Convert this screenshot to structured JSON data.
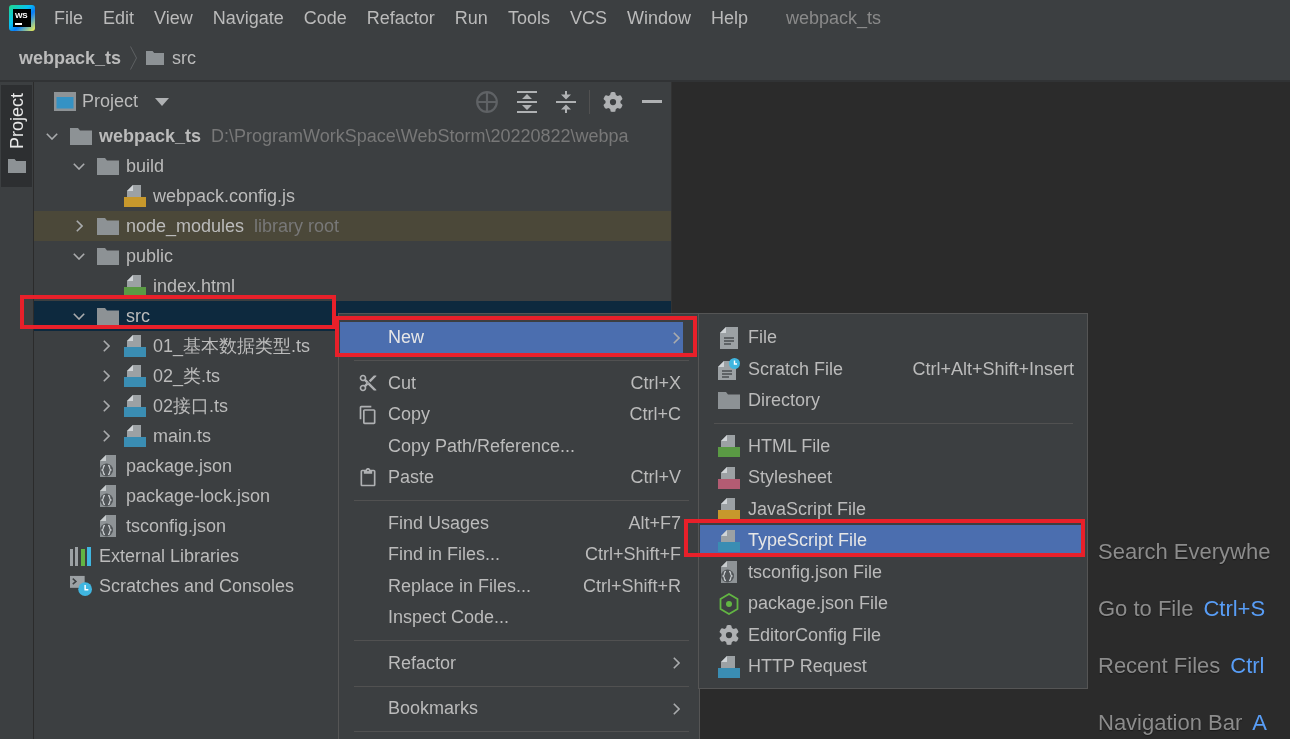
{
  "app_logo": {
    "text": "WS"
  },
  "menu_bar": {
    "items": [
      "File",
      "Edit",
      "View",
      "Navigate",
      "Code",
      "Refactor",
      "Run",
      "Tools",
      "VCS",
      "Window",
      "Help"
    ],
    "title": "webpack_ts"
  },
  "breadcrumbs": [
    {
      "label": "webpack_ts",
      "kind": "project"
    },
    {
      "label": "src",
      "kind": "folder"
    }
  ],
  "tool_strip": {
    "tabs": [
      {
        "label": "Project",
        "selected": true
      }
    ]
  },
  "project_panel": {
    "title": "Project",
    "tree": [
      {
        "label": "webpack_ts",
        "hint": "D:\\ProgramWorkSpace\\WebStorm\\20220822\\webpa",
        "kind": "project",
        "expanded": true,
        "selected": false,
        "annotated": false,
        "children": [
          {
            "label": "build",
            "kind": "folder",
            "expanded": true,
            "selected": false,
            "annotated": false,
            "children": [
              {
                "label": "webpack.config.js",
                "kind": "js",
                "selected": false,
                "annotated": false
              }
            ]
          },
          {
            "label": "node_modules",
            "hint": "library root",
            "kind": "library_root",
            "expanded": false,
            "selected": false,
            "annotated": false
          },
          {
            "label": "public",
            "kind": "folder",
            "expanded": true,
            "selected": false,
            "annotated": false,
            "children": [
              {
                "label": "index.html",
                "kind": "html",
                "selected": false,
                "annotated": false
              }
            ]
          },
          {
            "label": "src",
            "kind": "folder",
            "expanded": true,
            "selected": true,
            "annotated": true,
            "children": [
              {
                "label": "01_基本数据类型.ts",
                "kind": "ts",
                "expanded": false,
                "selected": false,
                "annotated": false
              },
              {
                "label": "02_类.ts",
                "kind": "ts",
                "expanded": false,
                "selected": false,
                "annotated": false
              },
              {
                "label": "02接口.ts",
                "kind": "ts",
                "expanded": false,
                "selected": false,
                "annotated": false
              },
              {
                "label": "main.ts",
                "kind": "ts",
                "expanded": false,
                "selected": false,
                "annotated": false
              }
            ]
          },
          {
            "label": "package.json",
            "kind": "json",
            "selected": false,
            "annotated": false
          },
          {
            "label": "package-lock.json",
            "kind": "json",
            "selected": false,
            "annotated": false
          },
          {
            "label": "tsconfig.json",
            "kind": "json",
            "selected": false,
            "annotated": false
          }
        ]
      },
      {
        "label": "External Libraries",
        "kind": "libraries",
        "selected": false,
        "annotated": false
      },
      {
        "label": "Scratches and Consoles",
        "kind": "scratches",
        "selected": false,
        "annotated": false
      }
    ]
  },
  "context_menu": {
    "groups": [
      [
        {
          "label": "New",
          "kind": "plain",
          "submenu": true,
          "selected": true,
          "annotated": true
        }
      ],
      [
        {
          "label": "Cut",
          "kind": "cut",
          "shortcut": "Ctrl+X",
          "submenu": false,
          "selected": false,
          "annotated": false
        },
        {
          "label": "Copy",
          "kind": "copy",
          "shortcut": "Ctrl+C",
          "submenu": false,
          "selected": false,
          "annotated": false
        },
        {
          "label": "Copy Path/Reference...",
          "kind": "plain",
          "submenu": false,
          "selected": false,
          "annotated": false
        },
        {
          "label": "Paste",
          "kind": "paste",
          "shortcut": "Ctrl+V",
          "submenu": false,
          "selected": false,
          "annotated": false
        }
      ],
      [
        {
          "label": "Find Usages",
          "kind": "plain",
          "shortcut": "Alt+F7",
          "submenu": false,
          "selected": false,
          "annotated": false
        },
        {
          "label": "Find in Files...",
          "kind": "plain",
          "shortcut": "Ctrl+Shift+F",
          "submenu": false,
          "selected": false,
          "annotated": false
        },
        {
          "label": "Replace in Files...",
          "kind": "plain",
          "shortcut": "Ctrl+Shift+R",
          "submenu": false,
          "selected": false,
          "annotated": false
        },
        {
          "label": "Inspect Code...",
          "kind": "plain",
          "submenu": false,
          "selected": false,
          "annotated": false
        }
      ],
      [
        {
          "label": "Refactor",
          "kind": "plain",
          "submenu": true,
          "selected": false,
          "annotated": false
        }
      ],
      [
        {
          "label": "Bookmarks",
          "kind": "plain",
          "submenu": true,
          "selected": false,
          "annotated": false
        }
      ]
    ]
  },
  "new_submenu": {
    "groups": [
      [
        {
          "label": "File",
          "kind": "file",
          "selected": false,
          "annotated": false
        },
        {
          "label": "Scratch File",
          "kind": "scratch",
          "shortcut": "Ctrl+Alt+Shift+Insert",
          "selected": false,
          "annotated": false
        },
        {
          "label": "Directory",
          "kind": "directory",
          "selected": false,
          "annotated": false
        }
      ],
      [
        {
          "label": "HTML File",
          "kind": "html",
          "selected": false,
          "annotated": false
        },
        {
          "label": "Stylesheet",
          "kind": "css",
          "selected": false,
          "annotated": false
        },
        {
          "label": "JavaScript File",
          "kind": "js",
          "selected": false,
          "annotated": false
        },
        {
          "label": "TypeScript File",
          "kind": "ts",
          "selected": true,
          "annotated": true
        },
        {
          "label": "tsconfig.json File",
          "kind": "tsconfig",
          "selected": false,
          "annotated": false
        },
        {
          "label": "package.json File",
          "kind": "package",
          "selected": false,
          "annotated": false
        },
        {
          "label": "EditorConfig File",
          "kind": "editorconfig",
          "selected": false,
          "annotated": false
        },
        {
          "label": "HTTP Request",
          "kind": "http",
          "selected": false,
          "annotated": false
        }
      ]
    ]
  },
  "editor_hints": [
    {
      "label": "Search Everywhe"
    },
    {
      "label": "Go to File",
      "shortcut": "Ctrl+S"
    },
    {
      "label": "Recent Files",
      "shortcut": "Ctrl"
    },
    {
      "label": "Navigation Bar",
      "shortcut": "A"
    }
  ]
}
